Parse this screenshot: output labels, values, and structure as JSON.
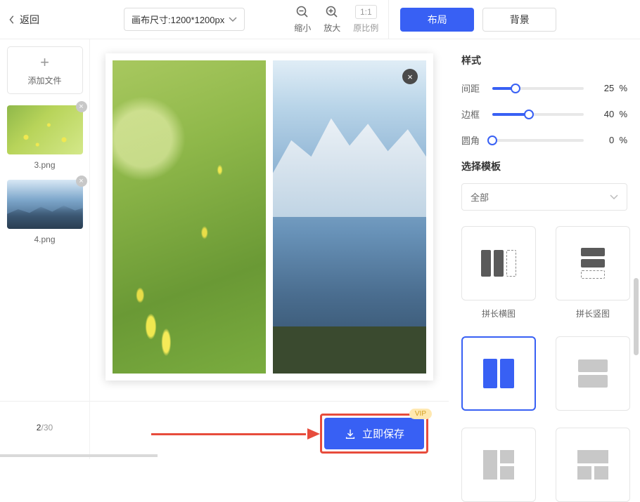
{
  "toolbar": {
    "back_label": "返回",
    "canvas_size_label": "画布尺寸:1200*1200px",
    "zoom_out_label": "缩小",
    "zoom_in_label": "放大",
    "ratio_display": "1:1",
    "ratio_label": "原比例"
  },
  "tabs": {
    "layout_label": "布局",
    "background_label": "背景"
  },
  "sidebar": {
    "add_file_label": "添加文件",
    "thumbs": [
      {
        "name": "3.png"
      },
      {
        "name": "4.png"
      }
    ],
    "page_current": "2",
    "page_sep": "/",
    "page_total": "30"
  },
  "save": {
    "vip_badge": "VIP",
    "button_label": "立即保存"
  },
  "panel": {
    "style_title": "样式",
    "sliders": {
      "spacing_label": "间距",
      "spacing_value": "25",
      "spacing_pct": 25,
      "border_label": "边框",
      "border_value": "40",
      "border_pct": 40,
      "radius_label": "圆角",
      "radius_value": "0",
      "radius_pct": 0,
      "unit": "%"
    },
    "template_title": "选择模板",
    "select_value": "全部",
    "templates": {
      "horiz_label": "拼长横图",
      "vert_label": "拼长竖图"
    }
  }
}
